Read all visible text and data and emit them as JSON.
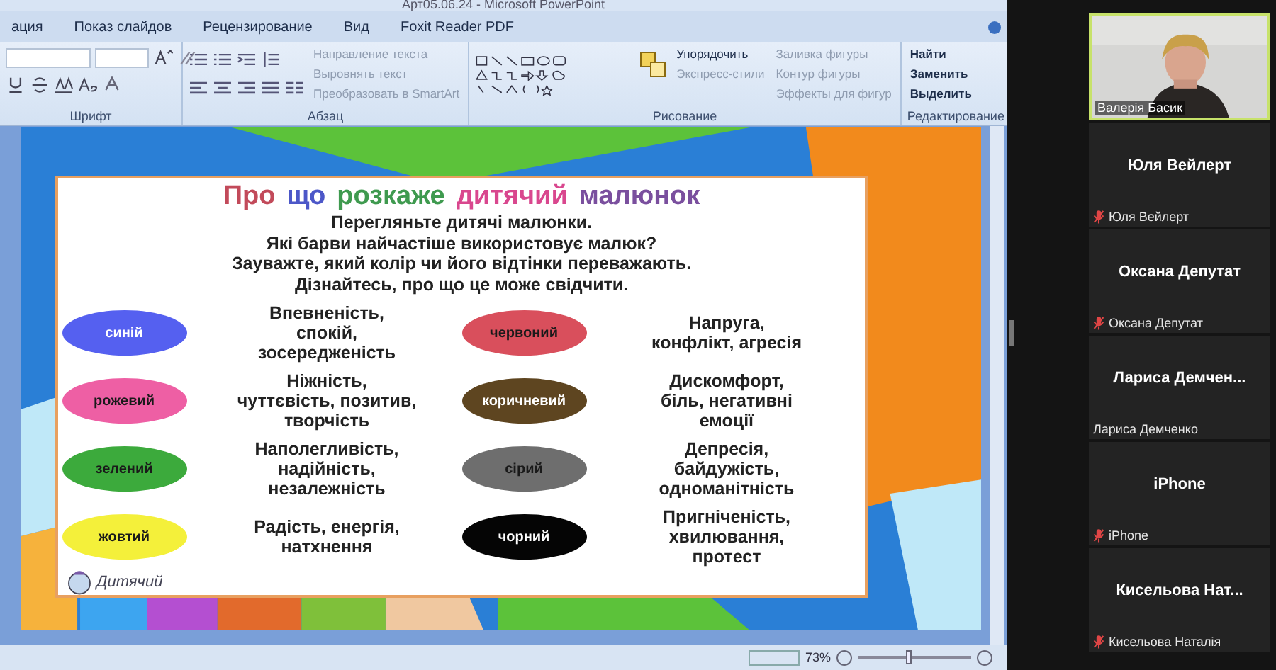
{
  "window": {
    "title": "Арт05.06.24 - Microsoft PowerPoint"
  },
  "ribbon_tabs": [
    {
      "label": "ация",
      "selected": false
    },
    {
      "label": "Показ слайдов",
      "selected": false
    },
    {
      "label": "Рецензирование",
      "selected": false
    },
    {
      "label": "Вид",
      "selected": false
    },
    {
      "label": "Foxit Reader PDF",
      "selected": false
    }
  ],
  "ribbon": {
    "groups": [
      {
        "label": "Шрифт",
        "kind": "font"
      },
      {
        "label": "Абзац",
        "kind": "paragraph",
        "commands": [
          {
            "label": "Направление текста",
            "disabled": true
          },
          {
            "label": "Выровнять текст",
            "disabled": true
          },
          {
            "label": "Преобразовать в SmartArt",
            "disabled": true
          }
        ]
      },
      {
        "label": "Рисование",
        "kind": "drawing",
        "commands": [
          {
            "label": "Упорядочить",
            "disabled": false
          },
          {
            "label": "Экспресс-стили",
            "disabled": true
          },
          {
            "label": "Заливка фигуры",
            "disabled": true
          },
          {
            "label": "Контур фигуры",
            "disabled": true
          },
          {
            "label": "Эффекты для фигур",
            "disabled": true
          }
        ]
      },
      {
        "label": "Редактирование",
        "kind": "editing",
        "commands": [
          {
            "label": "Найти",
            "disabled": false
          },
          {
            "label": "Заменить",
            "disabled": false
          },
          {
            "label": "Выделить",
            "disabled": false
          }
        ]
      }
    ]
  },
  "slide": {
    "title_words": [
      {
        "text": "Про",
        "color": "#c24a5a"
      },
      {
        "text": "що",
        "color": "#4c57c8"
      },
      {
        "text": "розкаже",
        "color": "#3f9a4f"
      },
      {
        "text": "дитячий",
        "color": "#d9478e"
      },
      {
        "text": "малюнок",
        "color": "#7a4f9e"
      }
    ],
    "instructions": [
      "Перегляньте дитячі малюнки.",
      "Які барви найчастіше використовує малюк?",
      "Зауважте, який колір чи його відтінки переважають.",
      "Дізнайтесь, про що це може свідчити."
    ],
    "items": [
      {
        "label": "синій",
        "color": "#5560f0",
        "meaning": "Впевненість,\nспокій,\nзосередженість"
      },
      {
        "label": "рожевий",
        "color": "#ee5fa4",
        "meaning": "Ніжність,\nчуттєвість, позитив,\nтворчість"
      },
      {
        "label": "зелений",
        "color": "#3caa3c",
        "meaning": "Наполегливість,\nнадійність,\nнезалежність"
      },
      {
        "label": "жовтий",
        "color": "#f4f03a",
        "meaning": "Радість, енергія,\nнатхнення"
      },
      {
        "label": "червоний",
        "color": "#d94f5c",
        "meaning": "Напруга,\nконфлікт, агресія"
      },
      {
        "label": "коричневий",
        "color": "#5e4520",
        "meaning": "Дискомфорт,\nбіль, негативні\nемоції"
      },
      {
        "label": "сірий",
        "color": "#6e6e6e",
        "meaning": "Депресія,\nбайдужість,\nодноманітність"
      },
      {
        "label": "чорний",
        "color": "#050505",
        "meaning": "Пригніченість,\nхвилювання,\nпротест"
      }
    ],
    "logo": "Дитячий"
  },
  "status_bar": {
    "zoom": "73%",
    "level": 0.45
  },
  "participants": [
    {
      "kind": "video",
      "label": "Валерія Басик"
    },
    {
      "kind": "name",
      "name": "Юля Вейлерт",
      "label": "Юля Вейлерт",
      "muted": true
    },
    {
      "kind": "name",
      "name": "Оксана Депутат",
      "label": "Оксана Депутат",
      "muted": true
    },
    {
      "kind": "name",
      "name": "Лариса  Демчен...",
      "label": "Лариса Демченко",
      "muted": false
    },
    {
      "kind": "name",
      "name": "iPhone",
      "label": "iPhone",
      "muted": true
    },
    {
      "kind": "name",
      "name": "Кисельова  Нат...",
      "label": "Кисельова Наталія",
      "muted": true
    }
  ]
}
